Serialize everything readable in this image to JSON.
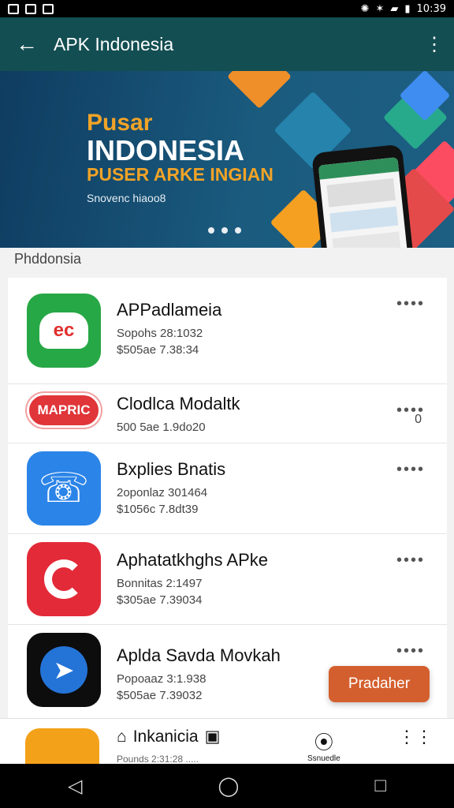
{
  "status": {
    "time": "10:39"
  },
  "appbar": {
    "title": "APK Indonesia"
  },
  "banner": {
    "line1": "Pusar",
    "line2": "INDONESIA",
    "line3": "PUSER ARKE INGIAN",
    "line4": "Snovenc hiaoo8"
  },
  "section": {
    "title": "Phddonsia"
  },
  "apps": [
    {
      "name": "APPadlameia",
      "line1": "Sopohs 28:1032",
      "line2": "$505ae 7.38:34",
      "icon": "green-badge-icon"
    },
    {
      "name": "Clodlca Modaltk",
      "line1": "500 5ae 1.9do20",
      "line2": "",
      "badge": "MAPRIC",
      "count": "0"
    },
    {
      "name": "Bxplies Bnatis",
      "line1": "2oponlaz 301464",
      "line2": "$1056c 7.8dt39",
      "icon": "phone-icon"
    },
    {
      "name": "Aphatatkhghs APke",
      "line1": "Bonnitas 2:1497",
      "line2": "$305ae 7.39034",
      "icon": "music-icon"
    },
    {
      "name": "Aplda Savda Movkah",
      "line1": "Popoaaz 3:1.938",
      "line2": "$505ae 7.39032",
      "icon": "compass-icon",
      "button": "Pradaher"
    }
  ],
  "tabs": {
    "home": "Inkanicia",
    "location": "Ssnuedle",
    "home_sub": "Pounds 2:31:28 ....."
  }
}
